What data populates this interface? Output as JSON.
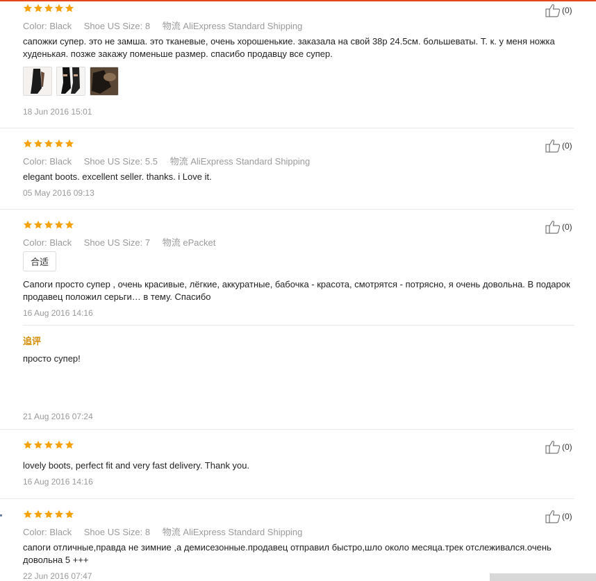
{
  "reviews": [
    {
      "color_label": "Color:",
      "color_value": "Black",
      "size_label": "Shoe US Size:",
      "size_value": "8",
      "logistics_label": "物流",
      "logistics_value": "AliExpress Standard Shipping",
      "text": "сапожки супер. это не замша. это тканевые, очень хорошенькие. заказала на свой 38р 24.5см. большеваты. Т. к. у меня ножка худенькая. позже закажу поменьше размер. спасибо продавцу все супер.",
      "date": "18 Jun 2016 15:01",
      "likes": "(0)",
      "rating": 5
    },
    {
      "color_label": "Color:",
      "color_value": "Black",
      "size_label": "Shoe US Size:",
      "size_value": "5.5",
      "logistics_label": "物流",
      "logistics_value": "AliExpress Standard Shipping",
      "text": "elegant boots. excellent seller. thanks. i Love it.",
      "date": "05 May 2016 09:13",
      "likes": "(0)",
      "rating": 5
    },
    {
      "color_label": "Color:",
      "color_value": "Black",
      "size_label": "Shoe US Size:",
      "size_value": "7",
      "logistics_label": "物流",
      "logistics_value": "ePacket",
      "tag": "合适",
      "text": "Сапоги просто супер , очень красивые, лёгкие, аккуратные, бабочка - красота, смотрятся - потрясно, я очень довольна. В подарок продавец положил серьги… в тему. Спасибо",
      "date": "16 Aug 2016 14:16",
      "additional_label": "追评",
      "additional_text": "просто супер!",
      "additional_date": "21 Aug 2016 07:24",
      "likes": "(0)",
      "rating": 5
    },
    {
      "text": "lovely boots, perfect fit and very fast delivery. Thank you.",
      "date": "16 Aug 2016 14:16",
      "likes": "(0)",
      "rating": 5
    },
    {
      "color_label": "Color:",
      "color_value": "Black",
      "size_label": "Shoe US Size:",
      "size_value": "8",
      "logistics_label": "物流",
      "logistics_value": "AliExpress Standard Shipping",
      "text": "сапоги отличные,правда не зимние ,а демисезонные.продавец отправил быстро,шло около месяца.трек отслеживался.очень довольна 5 +++",
      "date": "22 Jun 2016 07:47",
      "likes": "(0)",
      "rating": 5
    }
  ],
  "colors": {
    "star": "#f5a10a",
    "accent_bar": "#e8451e",
    "append_label": "#d58c00"
  },
  "icons": {
    "rating": "star-icon",
    "like": "thumbs-up-icon"
  }
}
